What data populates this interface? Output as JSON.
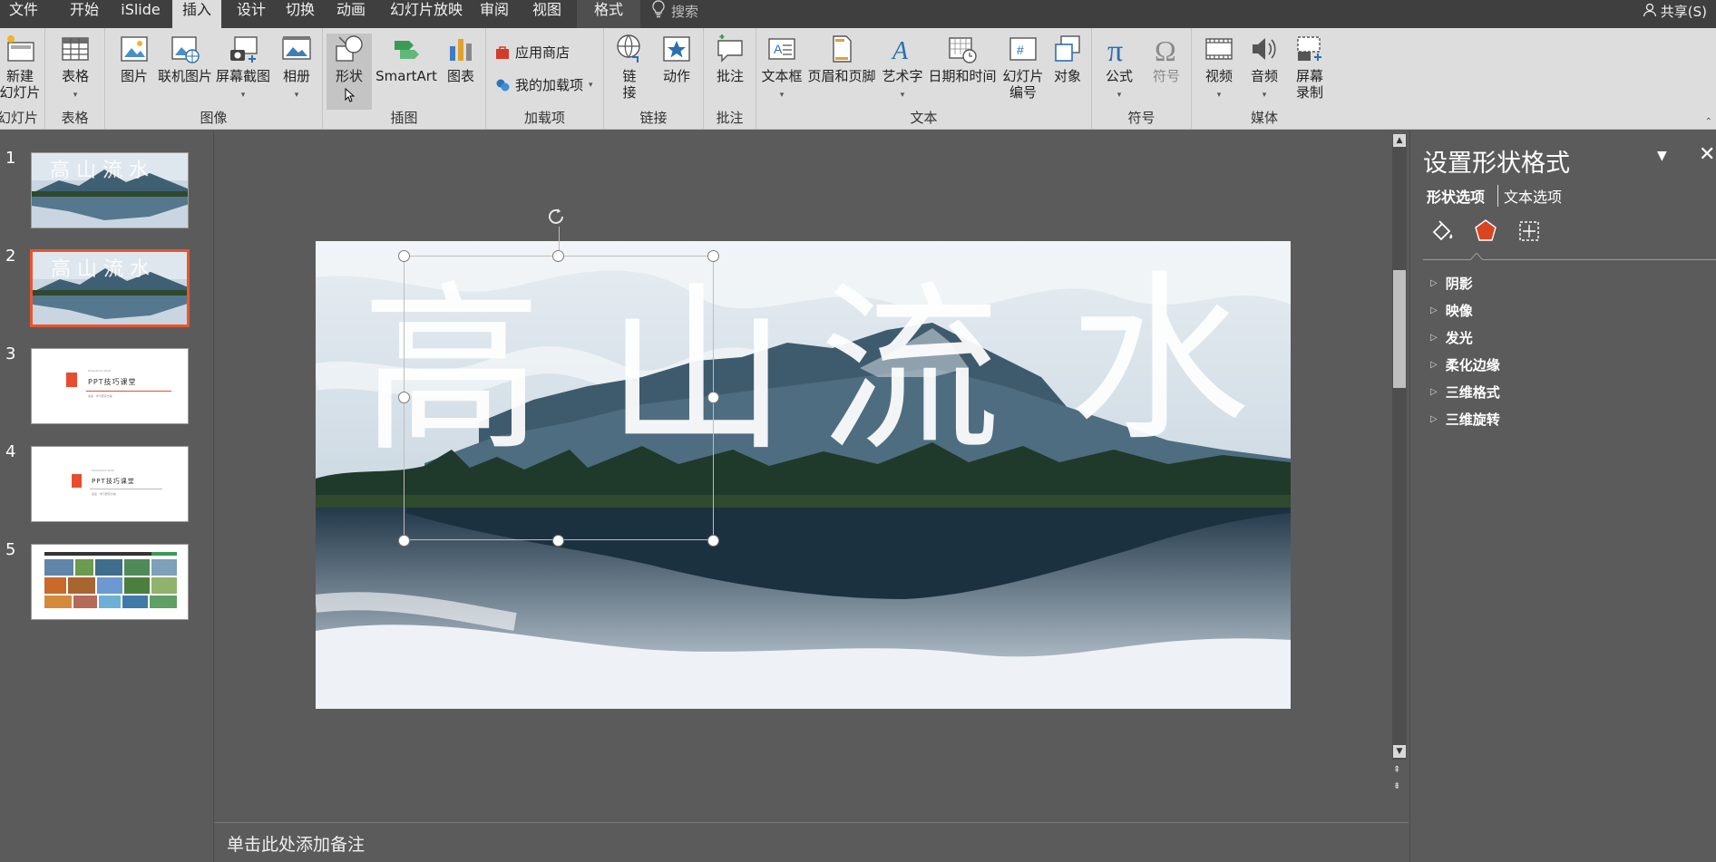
{
  "menu": {
    "tabs": [
      "文件",
      "开始",
      "iSlide",
      "插入",
      "设计",
      "切换",
      "动画",
      "幻灯片放映",
      "审阅",
      "视图",
      "格式"
    ],
    "active_tab": "插入",
    "search_placeholder": "搜索",
    "share_label": "共享(S)"
  },
  "ribbon": {
    "groups": {
      "slides": "幻灯片",
      "tables": "表格",
      "images": "图像",
      "illustrations": "插图",
      "addins": "加载项",
      "links": "链接",
      "comments": "批注",
      "text": "文本",
      "symbols": "符号",
      "media": "媒体"
    },
    "buttons": {
      "new_slide": [
        "新建",
        "幻灯片"
      ],
      "table": "表格",
      "picture": "图片",
      "online_picture": "联机图片",
      "screenshot": "屏幕截图",
      "album": "相册",
      "shapes": "形状",
      "smartart": "SmartArt",
      "chart": "图表",
      "store": "应用商店",
      "my_addins": "我的加载项",
      "link": [
        "链",
        "接"
      ],
      "action": "动作",
      "comment": "批注",
      "textbox": "文本框",
      "header_footer": "页眉和页脚",
      "wordart": "艺术字",
      "datetime": "日期和时间",
      "slide_number": [
        "幻灯片",
        "编号"
      ],
      "object": "对象",
      "equation": "公式",
      "symbol": "符号",
      "video": "视频",
      "audio": "音频",
      "screen_record": [
        "屏幕",
        "录制"
      ]
    }
  },
  "thumbnails": {
    "numbers": [
      "1",
      "2",
      "3",
      "4",
      "5"
    ],
    "selected": "2",
    "slide3": {
      "small": "PowerPoint 2016",
      "title": "PPT技巧课堂",
      "sub": "嘉嘉 · 学习研究方案"
    },
    "slide4": {
      "small": "PowerPoint 2016",
      "title": "PPT技巧课堂",
      "sub": "嘉嘉 · 学习研究方案"
    }
  },
  "slide": {
    "chars": [
      "高",
      "山",
      "流",
      "水"
    ]
  },
  "notes_placeholder": "单击此处添加备注",
  "format_pane": {
    "title": "设置形状格式",
    "tab_shape": "形状选项",
    "tab_text": "文本选项",
    "sections": [
      "阴影",
      "映像",
      "发光",
      "柔化边缘",
      "三维格式",
      "三维旋转"
    ]
  },
  "colors": {
    "accent_selected": "#e8562e",
    "ribbon_bg": "#dddddd",
    "menubar_bg": "#3f3f3f",
    "workspace_bg": "#5b5b5b"
  }
}
